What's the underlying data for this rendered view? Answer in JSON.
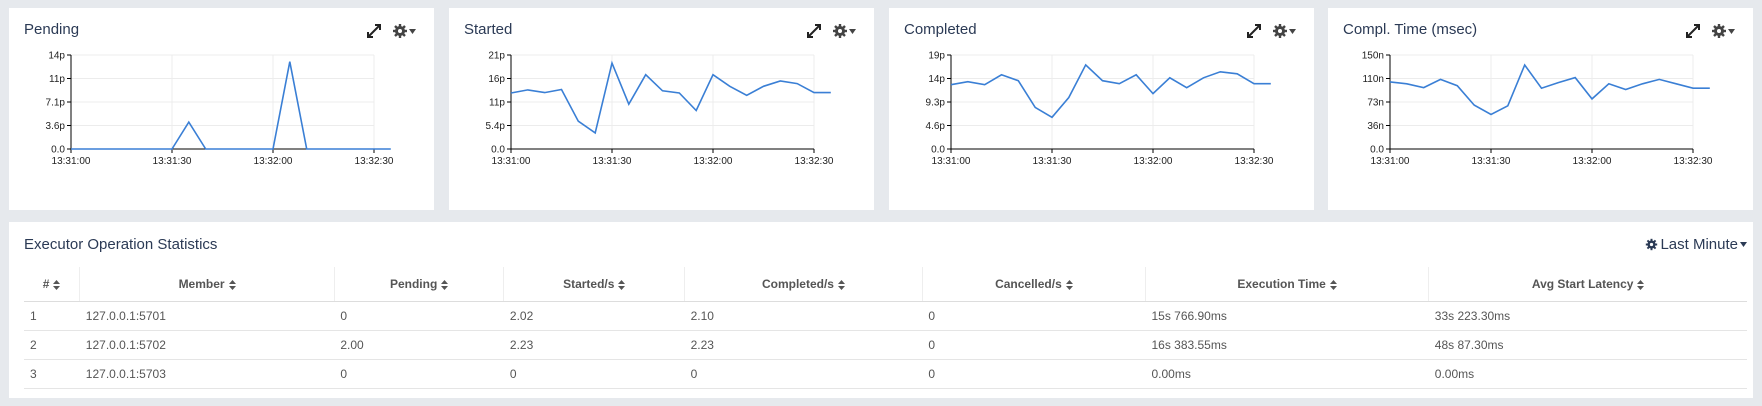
{
  "charts": [
    {
      "title": "Pending",
      "chart_data": {
        "type": "line",
        "title": "Pending",
        "y_ticks": [
          "14p",
          "11p",
          "7.1p",
          "3.6p",
          "0.0"
        ],
        "ylim": [
          0,
          14
        ],
        "x_ticks": [
          "13:31:00",
          "13:31:30",
          "13:32:00",
          "13:32:30"
        ],
        "x": [
          "13:31:00",
          "13:31:05",
          "13:31:10",
          "13:31:15",
          "13:31:20",
          "13:31:25",
          "13:31:30",
          "13:31:35",
          "13:31:40",
          "13:31:45",
          "13:31:50",
          "13:31:55",
          "13:32:00",
          "13:32:05",
          "13:32:10",
          "13:32:15",
          "13:32:20",
          "13:32:25",
          "13:32:30",
          "13:32:35"
        ],
        "values": [
          0,
          0,
          0,
          0,
          0,
          0,
          0,
          4,
          0,
          0,
          0,
          0,
          0,
          13,
          0,
          0,
          0,
          0,
          0,
          0
        ],
        "color": "#3a7fd5",
        "grid": true
      }
    },
    {
      "title": "Started",
      "chart_data": {
        "type": "line",
        "title": "Started",
        "y_ticks": [
          "21p",
          "16p",
          "11p",
          "5.4p",
          "0.0"
        ],
        "ylim": [
          0,
          21
        ],
        "x_ticks": [
          "13:31:00",
          "13:31:30",
          "13:32:00",
          "13:32:30"
        ],
        "x": [
          "13:31:00",
          "13:31:05",
          "13:31:10",
          "13:31:15",
          "13:31:20",
          "13:31:25",
          "13:31:30",
          "13:31:35",
          "13:31:40",
          "13:31:45",
          "13:31:50",
          "13:31:55",
          "13:32:00",
          "13:32:05",
          "13:32:10",
          "13:32:15",
          "13:32:20",
          "13:32:25",
          "13:32:30",
          "13:32:35"
        ],
        "values": [
          12.5,
          13.2,
          12.6,
          13.3,
          6.2,
          3.6,
          19.2,
          10.0,
          16.6,
          13.0,
          12.5,
          8.6,
          16.6,
          14.0,
          12.0,
          14.0,
          15.2,
          14.6,
          12.6,
          12.6
        ],
        "color": "#3a7fd5",
        "grid": true
      }
    },
    {
      "title": "Completed",
      "chart_data": {
        "type": "line",
        "title": "Completed",
        "y_ticks": [
          "19p",
          "14p",
          "9.3p",
          "4.6p",
          "0.0"
        ],
        "ylim": [
          0,
          19
        ],
        "x_ticks": [
          "13:31:00",
          "13:31:30",
          "13:32:00",
          "13:32:30"
        ],
        "x": [
          "13:31:00",
          "13:31:05",
          "13:31:10",
          "13:31:15",
          "13:31:20",
          "13:31:25",
          "13:31:30",
          "13:31:35",
          "13:31:40",
          "13:31:45",
          "13:31:50",
          "13:31:55",
          "13:32:00",
          "13:32:05",
          "13:32:10",
          "13:32:15",
          "13:32:20",
          "13:32:25",
          "13:32:30",
          "13:32:35"
        ],
        "values": [
          13.0,
          13.6,
          13.0,
          15.0,
          13.8,
          8.4,
          6.4,
          10.4,
          17.0,
          13.8,
          13.2,
          15.0,
          11.2,
          14.4,
          12.4,
          14.4,
          15.6,
          15.2,
          13.2,
          13.2
        ],
        "color": "#3a7fd5",
        "grid": true
      }
    },
    {
      "title": "Compl. Time (msec)",
      "chart_data": {
        "type": "line",
        "title": "Compl. Time (msec)",
        "y_ticks": [
          "150n",
          "110n",
          "73n",
          "36n",
          "0.0"
        ],
        "ylim": [
          0,
          150
        ],
        "x_ticks": [
          "13:31:00",
          "13:31:30",
          "13:32:00",
          "13:32:30"
        ],
        "x": [
          "13:31:00",
          "13:31:05",
          "13:31:10",
          "13:31:15",
          "13:31:20",
          "13:31:25",
          "13:31:30",
          "13:31:35",
          "13:31:40",
          "13:31:45",
          "13:31:50",
          "13:31:55",
          "13:32:00",
          "13:32:05",
          "13:32:10",
          "13:32:15",
          "13:32:20",
          "13:32:25",
          "13:32:30",
          "13:32:35"
        ],
        "values": [
          107,
          104,
          98,
          111,
          101,
          70,
          55,
          69,
          134,
          97,
          106,
          114,
          80,
          104,
          95,
          104,
          111,
          104,
          97,
          97
        ],
        "color": "#3a7fd5",
        "grid": true
      }
    }
  ],
  "table": {
    "title": "Executor Operation Statistics",
    "range_label": "Last Minute",
    "columns": [
      "#",
      "Member",
      "Pending",
      "Started/s",
      "Completed/s",
      "Cancelled/s",
      "Execution Time",
      "Avg Start Latency"
    ],
    "rows": [
      [
        "1",
        "127.0.0.1:5701",
        "0",
        "2.02",
        "2.10",
        "0",
        "15s 766.90ms",
        "33s 223.30ms"
      ],
      [
        "2",
        "127.0.0.1:5702",
        "2.00",
        "2.23",
        "2.23",
        "0",
        "16s 383.55ms",
        "48s 87.30ms"
      ],
      [
        "3",
        "127.0.0.1:5703",
        "0",
        "0",
        "0",
        "0",
        "0.00ms",
        "0.00ms"
      ]
    ]
  },
  "icons": {
    "expand": "expand-icon",
    "settings": "gear-icon",
    "sort": "sort-icon"
  }
}
